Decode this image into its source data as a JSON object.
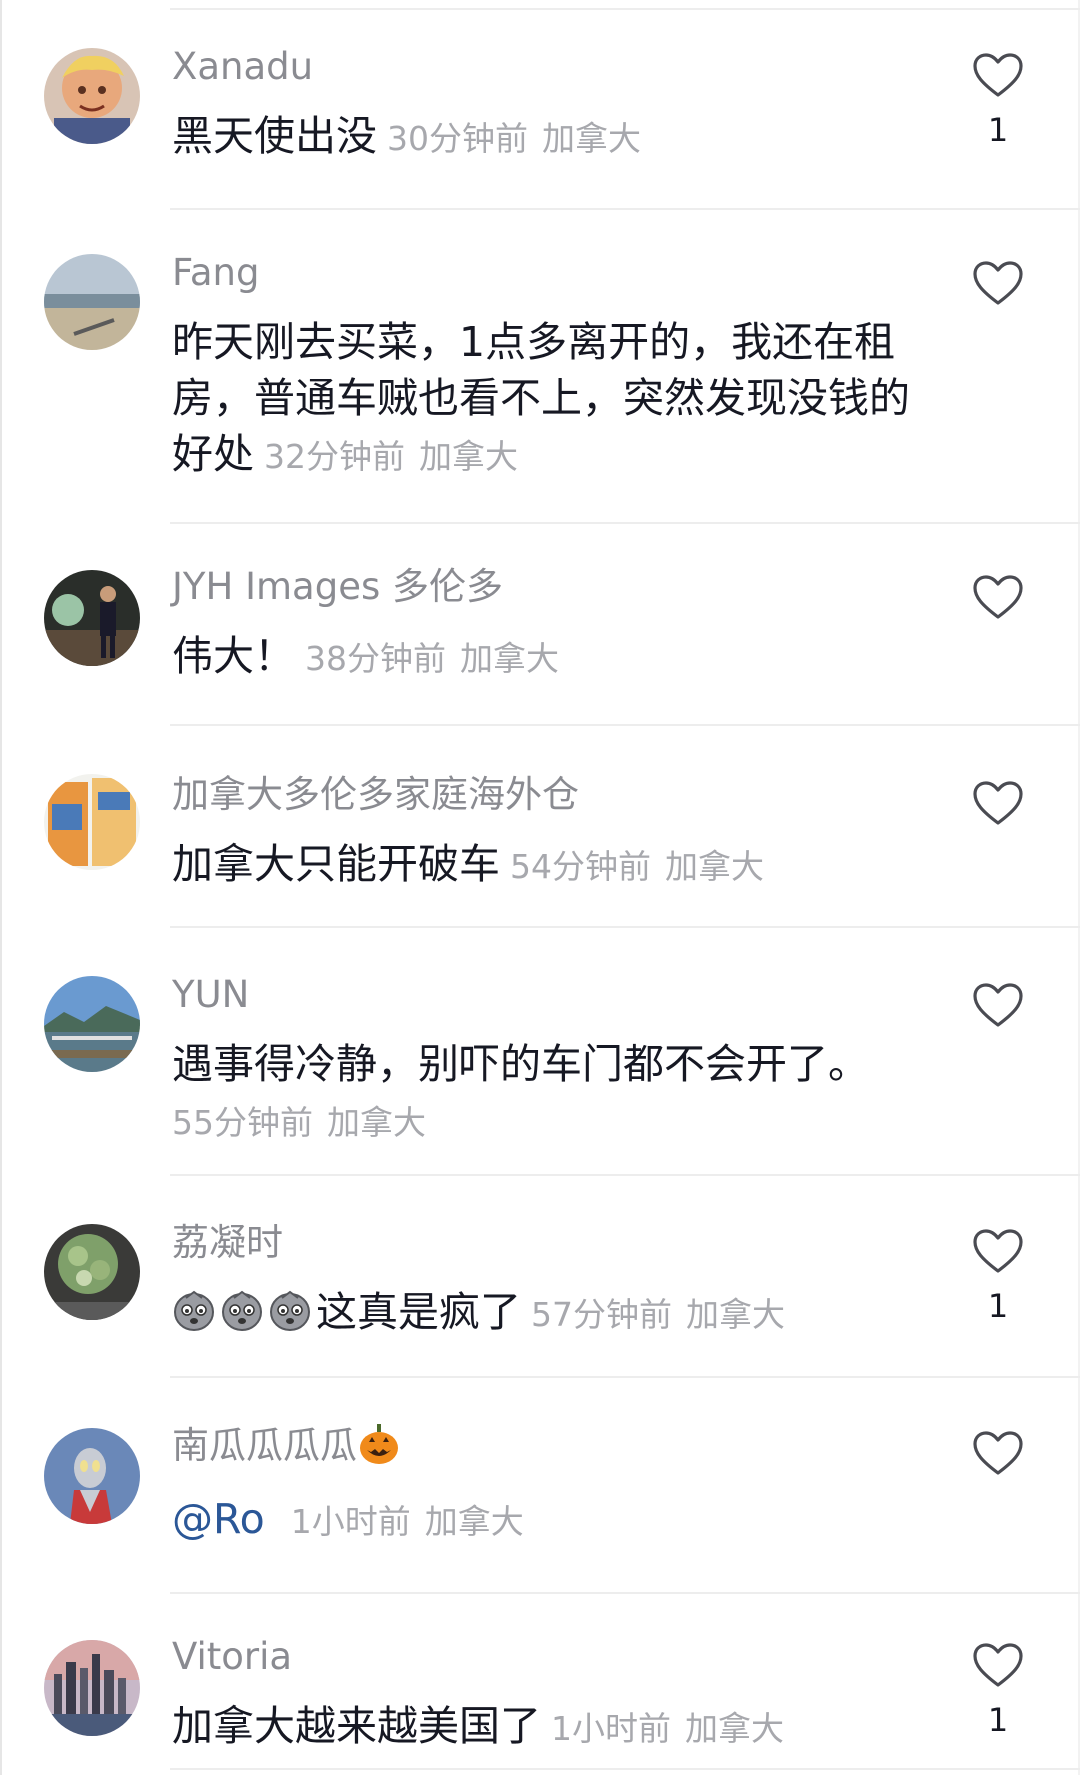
{
  "comments": [
    {
      "username": "Xanadu",
      "text": "黑天使出没",
      "time": "30分钟前",
      "region": "加拿大",
      "likes": "1",
      "avatar_icon": "anime-avatar-icon"
    },
    {
      "username": "Fang",
      "text": "昨天刚去买菜，1点多离开的，我还在租房，普通车贼也看不上，突然发现没钱的好处",
      "time": "32分钟前",
      "region": "加拿大",
      "likes": "",
      "avatar_icon": "beach-avatar-icon"
    },
    {
      "username": "JYH Images 多伦多",
      "text": "伟大！",
      "time": "38分钟前",
      "region": "加拿大",
      "likes": "",
      "avatar_icon": "person-avatar-icon"
    },
    {
      "username": "加拿大多伦多家庭海外仓",
      "text": "加拿大只能开破车",
      "time": "54分钟前",
      "region": "加拿大",
      "likes": "",
      "avatar_icon": "products-avatar-icon"
    },
    {
      "username": "YUN",
      "text": "遇事得冷静，别吓的车门都不会开了。",
      "time": "55分钟前",
      "region": "加拿大",
      "likes": "",
      "avatar_icon": "harbor-avatar-icon"
    },
    {
      "username": "荔凝时",
      "text": "这真是疯了",
      "time": "57分钟前",
      "region": "加拿大",
      "likes": "1",
      "avatar_icon": "bouquet-avatar-icon",
      "emoji_icon": "crying-face-emoji-icon"
    },
    {
      "username": "南瓜瓜瓜瓜",
      "username_emoji": "jack-o-lantern-icon",
      "text": "@Ro",
      "time": "1小时前",
      "region": "加拿大",
      "likes": "",
      "avatar_icon": "hero-avatar-icon"
    },
    {
      "username": "Vitoria",
      "text": "加拿大越来越美国了",
      "time": "1小时前",
      "region": "加拿大",
      "likes": "1",
      "avatar_icon": "city-avatar-icon"
    }
  ],
  "colors": {
    "username": "#8a8b91",
    "text": "#161823",
    "meta": "#a7a8ad",
    "mention": "#2b5797",
    "divider": "#ededed"
  }
}
